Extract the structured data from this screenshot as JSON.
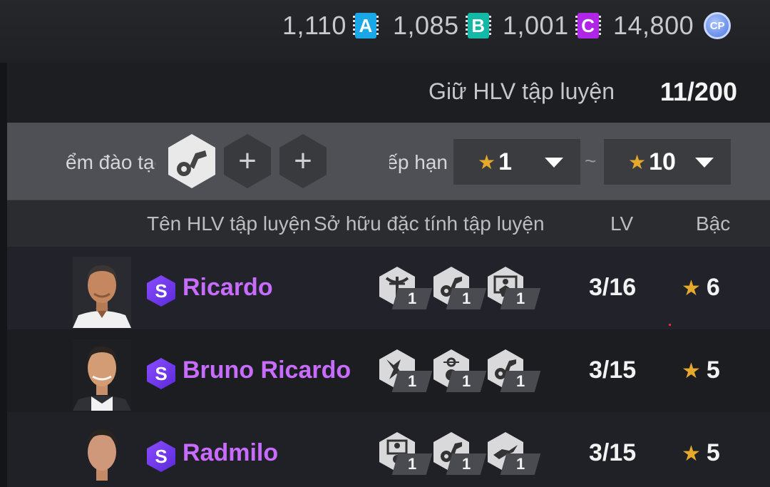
{
  "currencies": [
    {
      "value": "1,110",
      "badge": "A",
      "color": "#1aa7e8"
    },
    {
      "value": "1,085",
      "badge": "B",
      "color": "#14b8a6"
    },
    {
      "value": "1,001",
      "badge": "C",
      "color": "#b026e6"
    },
    {
      "value": "14,800",
      "badge": "CP",
      "color": "#5b86e5"
    }
  ],
  "keep": {
    "label": "Giữ HLV tập luyện",
    "value": "11/200"
  },
  "filter": {
    "slot_label": "ểm đào tạo",
    "add_symbol": "+",
    "rank_label": "Xếp hạn",
    "rank_from": "1",
    "rank_to": "10",
    "separator": "~"
  },
  "table": {
    "headers": {
      "name": "Tên HLV tập luyện",
      "traits": "Sở hữu đặc tính tập luyện",
      "lv": "LV",
      "grade": "Bậc"
    },
    "rows": [
      {
        "badge": "S",
        "name": "Ricardo",
        "traits": [
          {
            "icon": "crossbow-icon",
            "count": "1"
          },
          {
            "icon": "ball-boot-icon",
            "count": "1"
          },
          {
            "icon": "goalkeeper-icon",
            "count": "1"
          }
        ],
        "lv": "3/16",
        "grade": "6"
      },
      {
        "badge": "S",
        "name": "Bruno Ricardo",
        "traits": [
          {
            "icon": "sprint-player-icon",
            "count": "1"
          },
          {
            "icon": "ball-target-icon",
            "count": "1"
          },
          {
            "icon": "ball-boot-icon",
            "count": "1"
          }
        ],
        "lv": "3/15",
        "grade": "5"
      },
      {
        "badge": "S",
        "name": "Radmilo",
        "traits": [
          {
            "icon": "goal-ball-icon",
            "count": "1"
          },
          {
            "icon": "ball-boot-icon",
            "count": "1"
          },
          {
            "icon": "slide-tackle-icon",
            "count": "1"
          }
        ],
        "lv": "3/15",
        "grade": "5"
      }
    ]
  },
  "colors": {
    "accent_name": "#c86cff",
    "star": "#e6a92c"
  }
}
